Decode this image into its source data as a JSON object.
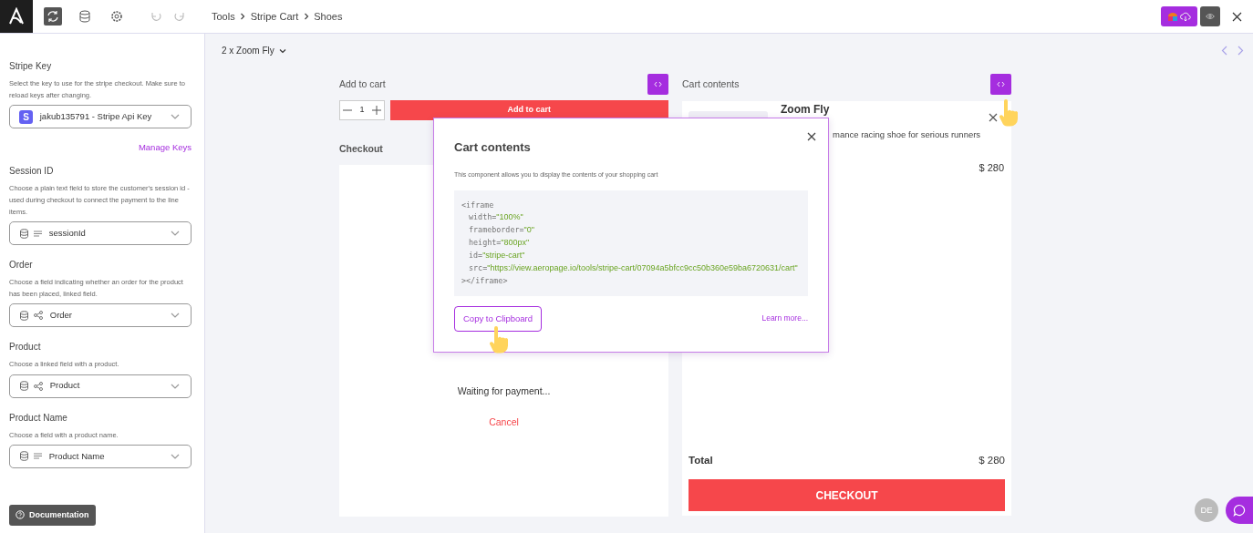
{
  "topbar": {
    "breadcrumb": [
      "Tools",
      "Stripe Cart",
      "Shoes"
    ]
  },
  "sidebar": {
    "fields": [
      {
        "label": "Stripe Key",
        "description": "Select the key to use for the stripe checkout. Make sure to reload keys after changing.",
        "kind": "stripe",
        "badge": "S",
        "value": "jakub135791 - Stripe Api Key",
        "link": "Manage Keys"
      },
      {
        "label": "Session ID",
        "description": "Choose a plain text field to store the customer's session id - used during checkout to connect the payment to the line items.",
        "kind": "text",
        "value": "sessionId"
      },
      {
        "label": "Order",
        "description": "Choose a field indicating whether an order for the product has been placed, linked field.",
        "kind": "linked",
        "value": "Order"
      },
      {
        "label": "Product",
        "description": "Choose a linked field with a product.",
        "kind": "linked",
        "value": "Product"
      },
      {
        "label": "Product Name",
        "description": "Choose a field with a product name.",
        "kind": "text",
        "value": "Product Name"
      }
    ],
    "doc_button": "Documentation"
  },
  "record_selector": "2 x Zoom Fly",
  "add_to_cart": {
    "title": "Add to cart",
    "quantity": "1",
    "button": "Add to cart"
  },
  "checkout": {
    "title": "Checkout",
    "status": "Waiting for payment...",
    "cancel": "Cancel"
  },
  "cart": {
    "title": "Cart contents",
    "item": {
      "name": "Zoom Fly",
      "description": "mance racing shoe for serious runners",
      "price": "$ 280"
    },
    "total_label": "Total",
    "total": "$ 280",
    "button": "CHECKOUT"
  },
  "modal": {
    "title": "Cart contents",
    "description": "This component allows you to display the contents of your shopping cart",
    "code": {
      "open": "<iframe",
      "assign": "=",
      "attributes": [
        {
          "name": "width",
          "value": "\"100%\""
        },
        {
          "name": "frameborder",
          "value": "\"0\""
        },
        {
          "name": "height",
          "value": "\"800px\""
        },
        {
          "name": "id",
          "value": "\"stripe-cart\""
        },
        {
          "name": "src",
          "value": "\"https://view.aeropage.io/tools/stripe-cart/07094a5bfcc9cc50b360e59ba6720631/cart\""
        }
      ],
      "close": "></iframe>"
    },
    "copy_button": "Copy to Clipboard",
    "learn_more": "Learn more..."
  },
  "user": {
    "initials": "DE"
  }
}
